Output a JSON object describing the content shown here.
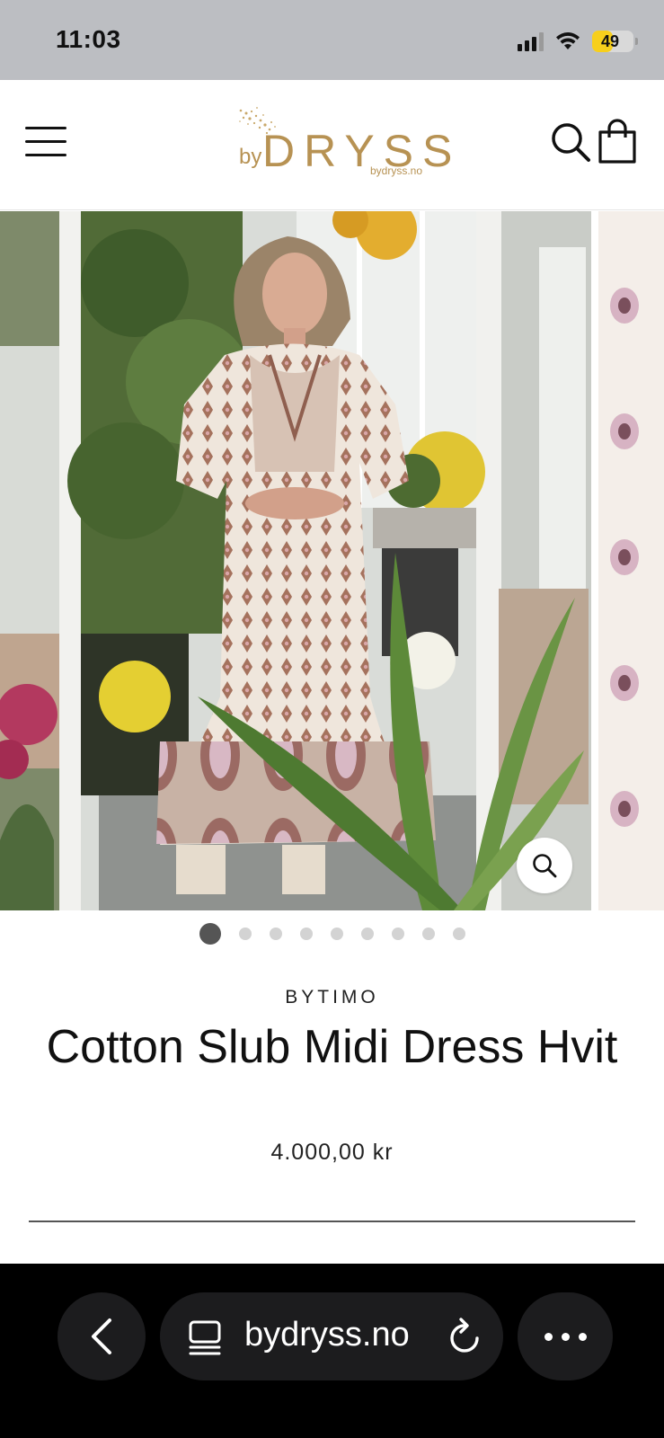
{
  "status_bar": {
    "time": "11:03",
    "battery_level": "49",
    "battery_fraction": 0.49,
    "icons": [
      "signal-icon",
      "wifi-icon",
      "battery-icon"
    ]
  },
  "header": {
    "logo_prefix": "by",
    "logo_name": "DRYSS",
    "logo_domain": "bydryss.no",
    "icons": [
      "menu-icon",
      "search-icon",
      "shopping-bag-icon"
    ]
  },
  "gallery": {
    "slide_count": 9,
    "active_index": 0,
    "icons": [
      "zoom-icon"
    ]
  },
  "product": {
    "brand": "BYTIMO",
    "title": "Cotton Slub Midi Dress Hvit",
    "price": "4.000,00 kr"
  },
  "browser": {
    "url": "bydryss.no",
    "icons": [
      "back-chevron-icon",
      "tabs-icon",
      "reload-icon",
      "more-icon"
    ]
  },
  "colors": {
    "status_bar_bg": "#bcbec2",
    "logo_gold": "#b79253",
    "battery_yellow": "#f7cf1c",
    "browser_bar_bg": "#000000",
    "browser_button_bg": "#1c1c1e"
  }
}
